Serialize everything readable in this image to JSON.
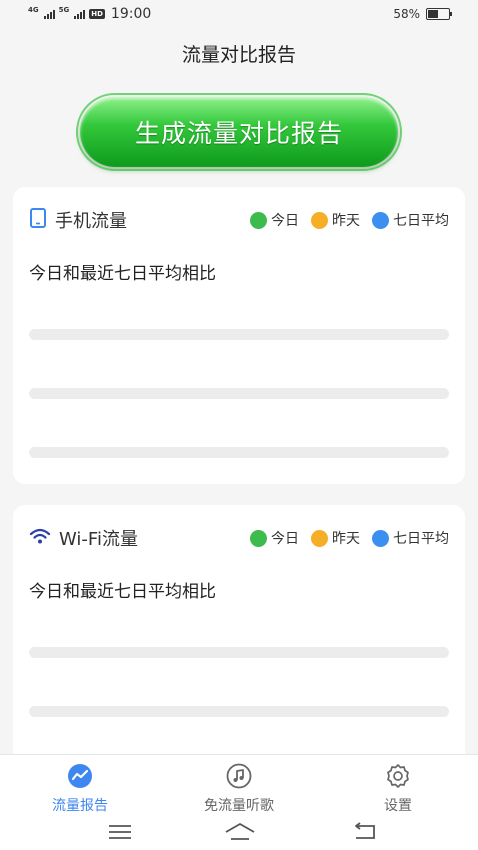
{
  "status_bar": {
    "signal1_label": "4G",
    "signal2_label": "5G",
    "hd_label": "HD",
    "time": "19:00",
    "battery_text": "58%",
    "battery_level": 0.58
  },
  "page": {
    "title": "流量对比报告"
  },
  "generate_button": {
    "label": "生成流量对比报告"
  },
  "legend": {
    "today": {
      "label": "今日",
      "color": "#3dbb4c"
    },
    "yesterday": {
      "label": "昨天",
      "color": "#f5ae25"
    },
    "seven_day": {
      "label": "七日平均",
      "color": "#3b8ff0"
    }
  },
  "mobile_card": {
    "title": "手机流量",
    "subtitle": "今日和最近七日平均相比"
  },
  "wifi_card": {
    "title": "Wi-Fi流量",
    "subtitle": "今日和最近七日平均相比"
  },
  "bottom_nav": {
    "items": [
      {
        "label": "流量报告",
        "icon": "report-icon",
        "active": true
      },
      {
        "label": "免流量听歌",
        "icon": "music-icon",
        "active": false
      },
      {
        "label": "设置",
        "icon": "gear-icon",
        "active": false
      }
    ]
  },
  "colors": {
    "accent": "#3e86f0",
    "button_green": "#22b530"
  }
}
